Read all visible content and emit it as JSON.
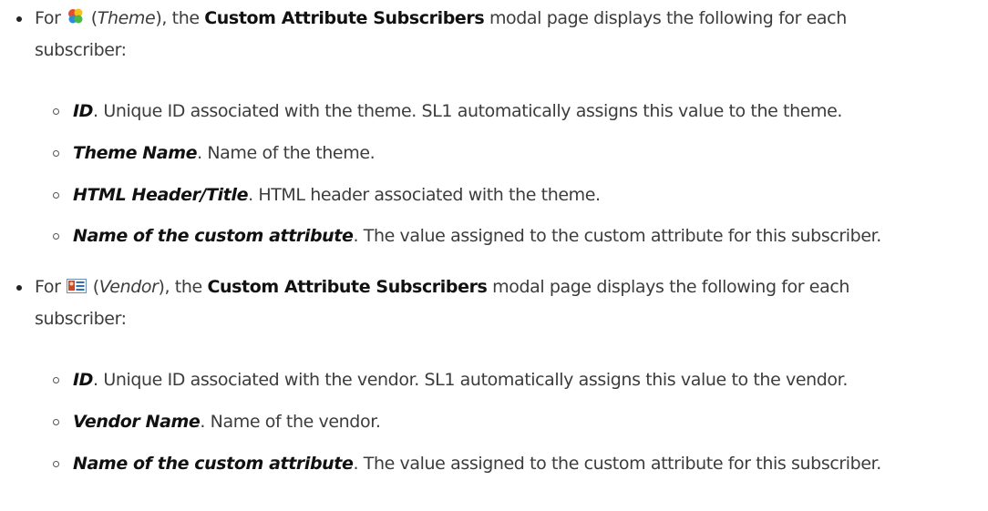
{
  "sections": [
    {
      "prefix": "For",
      "icon_name": "theme-icon",
      "type_label": "Theme",
      "mid": ", the",
      "page_name": "Custom Attribute Subscribers",
      "line1_rest": "modal page displays the following for each",
      "line2": "subscriber:",
      "items": [
        {
          "term": "ID",
          "desc": ". Unique ID associated with the theme. SL1 automatically assigns this value to the theme."
        },
        {
          "term": "Theme Name",
          "desc": ". Name of the theme."
        },
        {
          "term": "HTML Header/Title",
          "desc": ". HTML header associated with the theme."
        },
        {
          "term": "Name of the custom attribute",
          "desc": ". The value assigned to the custom attribute for this subscriber."
        }
      ]
    },
    {
      "prefix": "For",
      "icon_name": "vendor-icon",
      "type_label": "Vendor",
      "mid": ", the",
      "page_name": "Custom Attribute Subscribers",
      "line1_rest": "modal page displays the following for each",
      "line2": "subscriber:",
      "items": [
        {
          "term": "ID",
          "desc": ". Unique ID associated with the vendor. SL1 automatically assigns this value to the vendor."
        },
        {
          "term": "Vendor Name",
          "desc": ". Name of the vendor."
        },
        {
          "term": "Name of the custom attribute",
          "desc": ". The value assigned to the custom attribute for this subscriber."
        }
      ]
    }
  ]
}
